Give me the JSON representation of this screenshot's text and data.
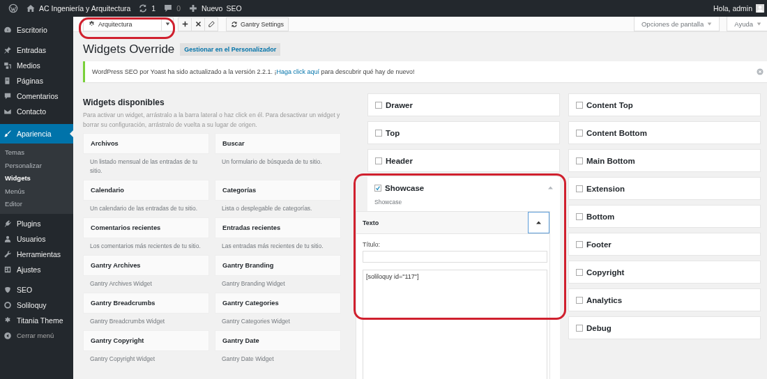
{
  "admin_bar": {
    "site": "AC Ingeniería y Arquitectura",
    "updates": "1",
    "comments": "0",
    "new": "Nuevo",
    "seo": "SEO",
    "greeting": "Hola, admin"
  },
  "sidebar": {
    "groups": [
      [
        {
          "label": "Escritorio",
          "kind": "menu",
          "selected": false
        }
      ],
      [
        {
          "label": "Entradas",
          "kind": "menu",
          "selected": false
        },
        {
          "label": "Medios",
          "kind": "menu",
          "selected": false
        },
        {
          "label": "Páginas",
          "kind": "menu",
          "selected": false
        },
        {
          "label": "Comentarios",
          "kind": "menu",
          "selected": false
        },
        {
          "label": "Contacto",
          "kind": "menu",
          "selected": false
        }
      ],
      [
        {
          "label": "Apariencia",
          "kind": "menu",
          "selected": true,
          "children": [
            {
              "label": "Temas",
              "selected": false
            },
            {
              "label": "Personalizar",
              "selected": false
            },
            {
              "label": "Widgets",
              "selected": true
            },
            {
              "label": "Menús",
              "selected": false
            },
            {
              "label": "Editor",
              "selected": false
            }
          ]
        },
        {
          "label": "Plugins",
          "kind": "menu",
          "selected": false
        },
        {
          "label": "Usuarios",
          "kind": "menu",
          "selected": false
        },
        {
          "label": "Herramientas",
          "kind": "menu",
          "selected": false
        },
        {
          "label": "Ajustes",
          "kind": "menu",
          "selected": false
        }
      ],
      [
        {
          "label": "SEO",
          "kind": "menu",
          "selected": false
        },
        {
          "label": "Soliloquy",
          "kind": "menu",
          "selected": false
        },
        {
          "label": "Titania Theme",
          "kind": "menu",
          "selected": false
        },
        {
          "label": "Cerrar menú",
          "kind": "collapse",
          "selected": false
        }
      ]
    ]
  },
  "toolbar": {
    "override": "Arquitectura",
    "settings": "Gantry Settings",
    "screen_options": "Opciones de pantalla",
    "help": "Ayuda"
  },
  "title": "Widgets Override",
  "customize_button": "Gestionar en el Personalizador",
  "notice": {
    "before": "WordPress SEO por Yoast ha sido actualizado a la versión 2.2.1. ¡",
    "link": "Haga click aquí",
    "after": " para descubrir qué hay de nuevo!"
  },
  "available": {
    "title": "Widgets disponibles",
    "description": "Para activar un widget, arrástralo a la barra lateral o haz click en él. Para desactivar un widget y borrar su configuración, arrástralo de vuelta a su lugar de origen.",
    "widgets": [
      {
        "name": "Archivos",
        "description": "Un listado mensual de las entradas de tu sitio."
      },
      {
        "name": "Buscar",
        "description": "Un formulario de búsqueda de tu sitio."
      },
      {
        "name": "Calendario",
        "description": "Un calendario de las entradas de tu sitio."
      },
      {
        "name": "Categorías",
        "description": "Lista o desplegable de categorías."
      },
      {
        "name": "Comentarios recientes",
        "description": "Los comentarios más recientes de tu sitio."
      },
      {
        "name": "Entradas recientes",
        "description": "Las entradas más recientes de tu sitio."
      },
      {
        "name": "Gantry Archives",
        "description": "Gantry Archives Widget"
      },
      {
        "name": "Gantry Branding",
        "description": "Gantry Branding Widget"
      },
      {
        "name": "Gantry Breadcrumbs",
        "description": "Gantry Breadcrumbs Widget"
      },
      {
        "name": "Gantry Categories",
        "description": "Gantry Categories Widget"
      },
      {
        "name": "Gantry Copyright",
        "description": "Gantry Copyright Widget"
      },
      {
        "name": "Gantry Date",
        "description": "Gantry Date Widget"
      }
    ]
  },
  "areas_left": [
    {
      "name": "Drawer",
      "checked": false,
      "expanded": false
    },
    {
      "name": "Top",
      "checked": false,
      "expanded": false
    },
    {
      "name": "Header",
      "checked": false,
      "expanded": false
    },
    {
      "name": "Showcase",
      "checked": true,
      "expanded": true,
      "description": "Showcase",
      "widget": {
        "title": "Texto",
        "title_label": "Título:",
        "text": "[soliloquy id=\"117\"]"
      }
    }
  ],
  "areas_right": [
    {
      "name": "Content Top",
      "checked": false,
      "expanded": false
    },
    {
      "name": "Content Bottom",
      "checked": false,
      "expanded": false
    },
    {
      "name": "Main Bottom",
      "checked": false,
      "expanded": false
    },
    {
      "name": "Extension",
      "checked": false,
      "expanded": false
    },
    {
      "name": "Bottom",
      "checked": false,
      "expanded": false
    },
    {
      "name": "Footer",
      "checked": false,
      "expanded": false
    },
    {
      "name": "Copyright",
      "checked": false,
      "expanded": false
    },
    {
      "name": "Analytics",
      "checked": false,
      "expanded": false
    },
    {
      "name": "Debug",
      "checked": false,
      "expanded": false
    }
  ]
}
